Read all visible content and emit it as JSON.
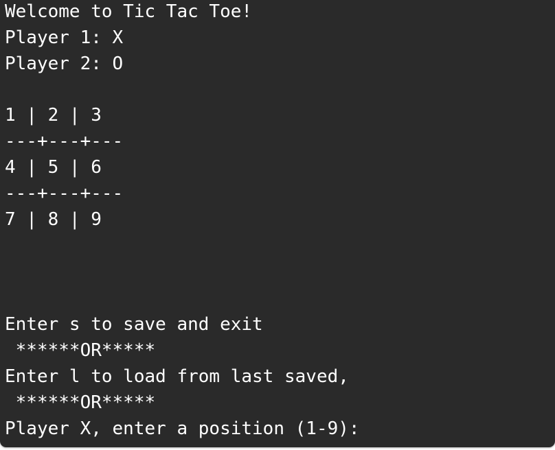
{
  "terminal": {
    "lines": {
      "welcome": "Welcome to Tic Tac Toe!",
      "player1": "Player 1: X",
      "player2": "Player 2: O",
      "board_row1": "1 | 2 | 3",
      "board_sep1": "---+---+---",
      "board_row2": "4 | 5 | 6",
      "board_sep2": "---+---+---",
      "board_row3": "7 | 8 | 9",
      "save_hint": "Enter s to save and exit",
      "or_sep1": " ******OR*****",
      "load_hint": "Enter l to load from last saved,",
      "or_sep2": " ******OR*****",
      "prompt": "Player X, enter a position (1-9):"
    },
    "colors": {
      "background": "#2a2a2a",
      "text": "#ffffff"
    }
  }
}
